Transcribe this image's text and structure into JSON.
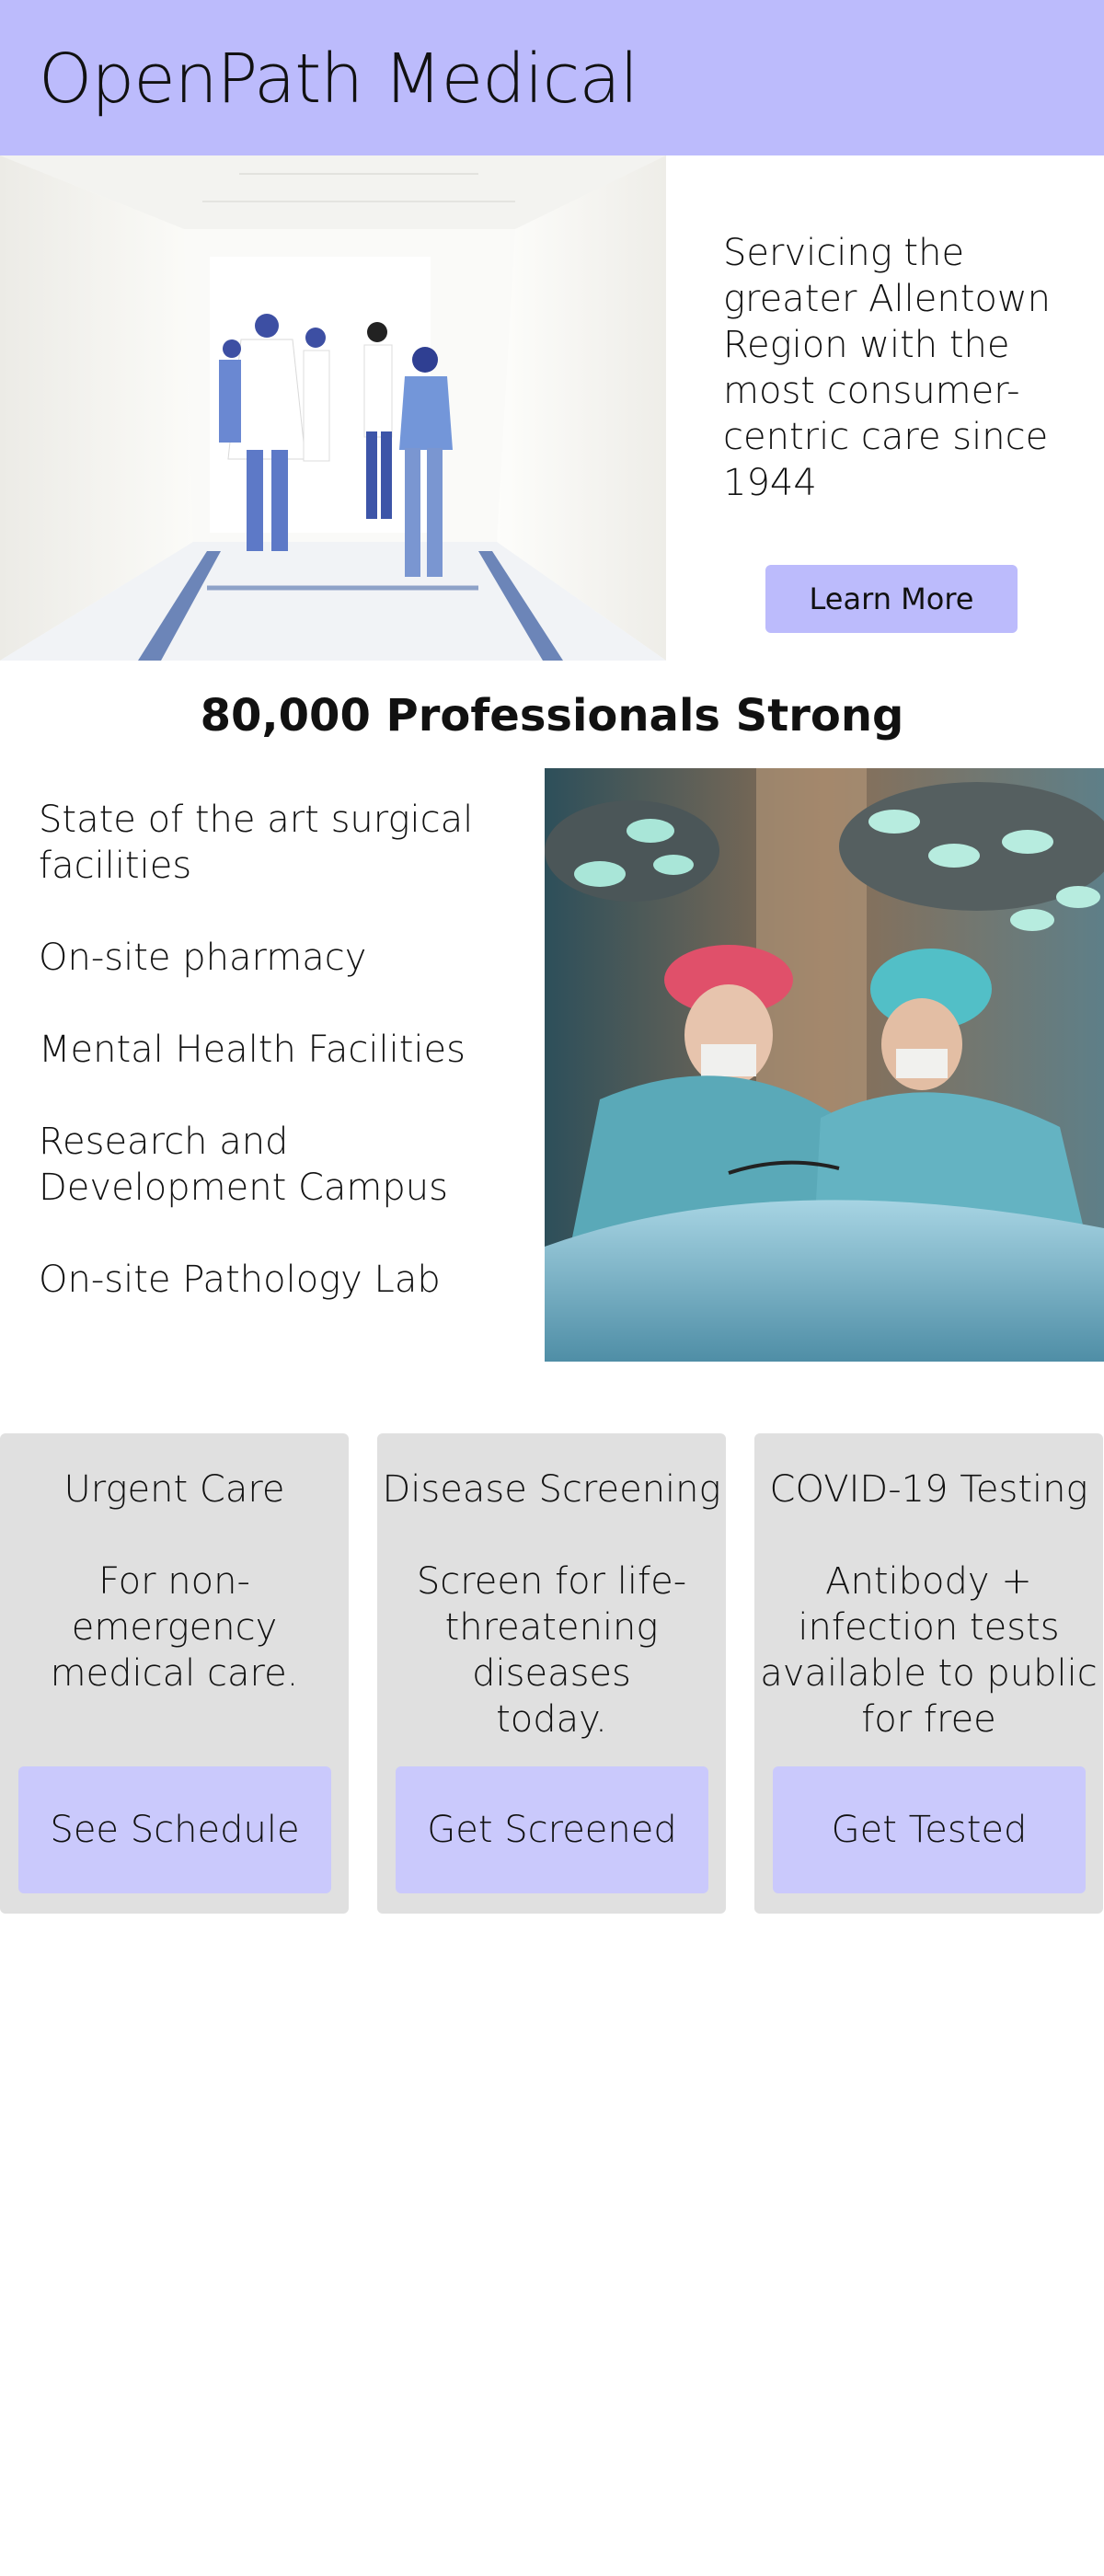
{
  "header": {
    "title": "OpenPath Medical"
  },
  "hero": {
    "tagline": "Servicing the greater Allentown Region with the most consumer-centric care since 1944",
    "cta_label": "Learn More"
  },
  "section": {
    "title": "80,000 Professionals Strong"
  },
  "features": [
    "State of the art surgical facilities",
    "On-site pharmacy",
    "Mental Health Facilities",
    "Research and Development Campus",
    "On-site Pathology Lab"
  ],
  "cards": [
    {
      "title": "Urgent Care",
      "description": "For non-emergency medical care.",
      "button": "See Schedule"
    },
    {
      "title": "Disease Screening",
      "description": "Screen for life-threatening diseases today.",
      "button": "Get Screened"
    },
    {
      "title": "COVID-19 Testing",
      "description": "Antibody + infection tests available to public for free",
      "button": "Get Tested"
    }
  ],
  "colors": {
    "header_bg": "#bcbbfc",
    "card_bg": "#e0e0e0",
    "card_button_bg": "#cac9fc"
  }
}
